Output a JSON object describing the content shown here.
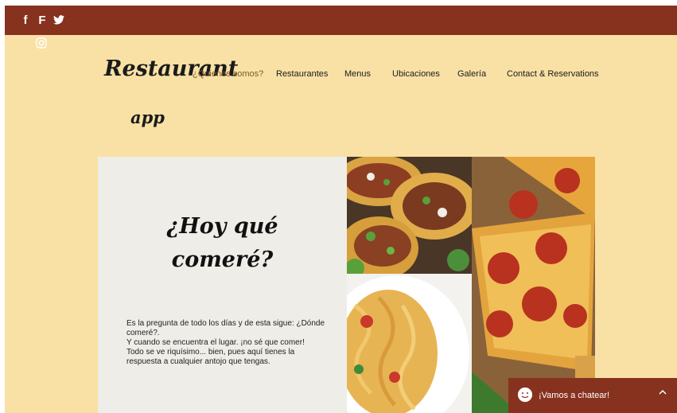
{
  "social": {
    "facebook": "f",
    "foursquare": "F",
    "twitter": "twitter-icon",
    "instagram": "instagram-icon"
  },
  "brand": {
    "line1": "Restaurant",
    "line2": "app"
  },
  "nav": {
    "items": [
      "¿Quienes somos?",
      "Restaurantes",
      "Menus",
      "Ubicaciones",
      "Galería",
      "Contact & Reservations"
    ]
  },
  "hero": {
    "headline_line1": "¿Hoy qué",
    "headline_line2": "comeré?",
    "paragraph_lines": [
      "Es la pregunta de todo los días y de esta sigue: ¿Dónde comeré?.",
      "Y cuando se encuentra el lugar. ¡no sé que comer!",
      "Todo se ve riquísimo... bien, pues aquí tienes la respuesta a cualquier antojo que tengas."
    ]
  },
  "gallery": {
    "images": [
      "tacos-image",
      "spaghetti-image",
      "pizza-image"
    ]
  },
  "chat": {
    "label": "¡Vamos a chatear!"
  },
  "colors": {
    "topbar": "#86321f",
    "background": "#f9e1a5",
    "panel": "#efede8",
    "chat": "#86321f"
  }
}
